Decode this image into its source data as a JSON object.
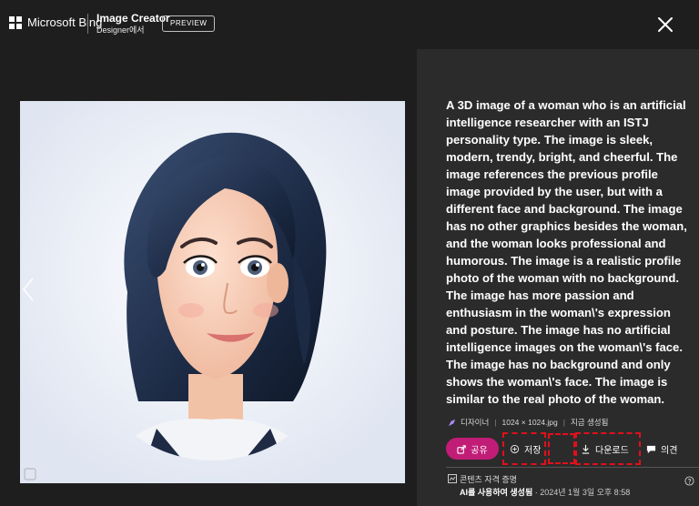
{
  "header": {
    "brand": "Microsoft Bing",
    "product_title": "Image Creator",
    "product_subtitle": "Designer에서",
    "preview_badge": "PREVIEW"
  },
  "colors": {
    "background": "#1f1e1f",
    "panel": "#2c2b2c",
    "share_button": "#c11d77",
    "highlight": "#e0101a"
  },
  "details": {
    "prompt": "A 3D image of a woman who is an artificial intelligence researcher with an ISTJ personality type. The image is sleek, modern, trendy, bright, and cheerful. The image references the previous profile image provided by the user, but with a different face and background. The image has no other graphics besides the woman, and the woman looks professional and humorous. The image is a realistic profile photo of the woman with no background. The image has more passion and enthusiasm in the woman\\'s expression and posture. The image has no artificial intelligence images on the woman\\'s face. The image has no background and only shows the woman\\'s face. The image is similar to the real photo of the woman.",
    "meta": {
      "source": "디자이너",
      "resolution": "1024 × 1024.jpg",
      "time": "지금 생성됨"
    },
    "actions": {
      "share": "공유",
      "save": "저장",
      "download": "다운로드",
      "feedback": "의견"
    },
    "credentials": {
      "title": "콘텐츠 자격 증명",
      "generated_bold": "AI를 사용하여 생성됨",
      "generated_rest": " · 2024년 1월 3일 오후 8:58"
    }
  },
  "icons": {
    "close": "close-icon",
    "previous": "chevron-left-icon",
    "share": "share-icon",
    "save": "save-icon",
    "download": "download-icon",
    "feedback": "comment-icon",
    "credentials": "credentials-icon",
    "help": "help-icon"
  }
}
